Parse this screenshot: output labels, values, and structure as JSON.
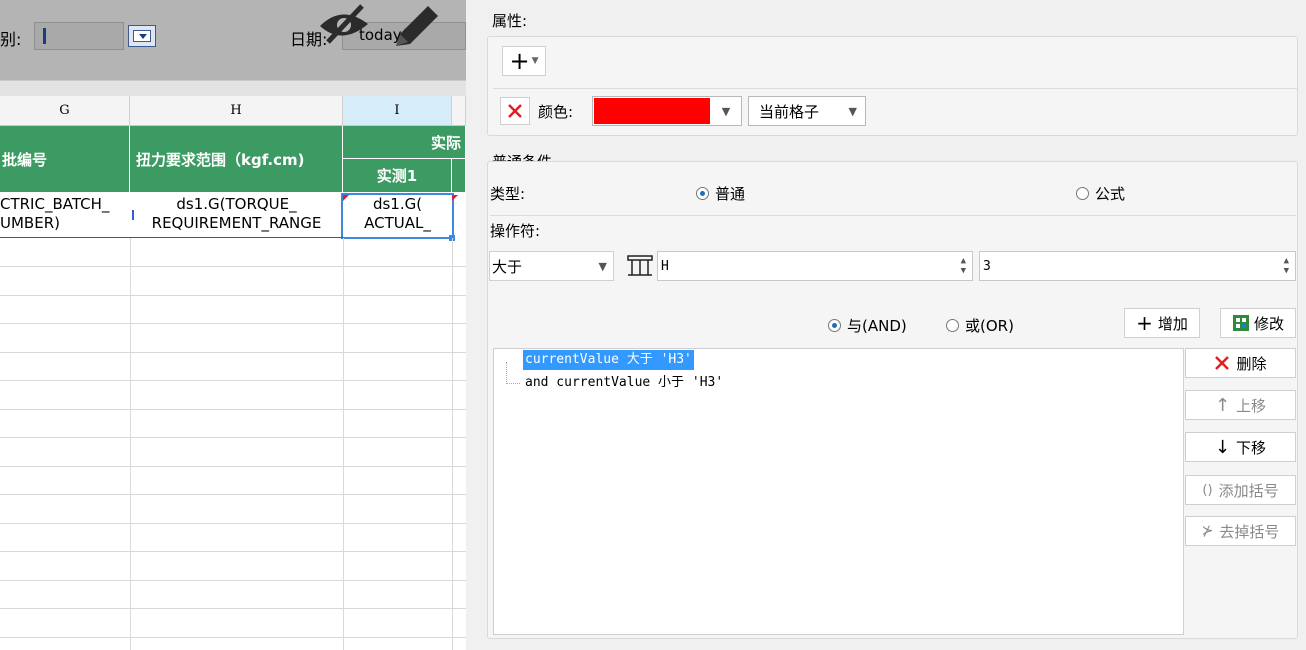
{
  "param_bar": {
    "category_label": "别:",
    "date_label": "日期:",
    "date_value": "today()"
  },
  "column_headers": [
    "G",
    "H",
    "I"
  ],
  "table_header": {
    "col_g": "批编号",
    "col_h": "扭力要求范围（kgf.cm)",
    "col_i_top": "实际",
    "col_i_sub": "实测1"
  },
  "data_row": {
    "col_g_line1": "CTRIC_BATCH_",
    "col_g_line2": "UMBER)",
    "col_h_line1": "ds1.G(TORQUE_",
    "col_h_line2": "REQUIREMENT_RANGE",
    "col_i_line1": "ds1.G(",
    "col_i_line2": "ACTUAL_"
  },
  "attributes": {
    "title": "属性:",
    "add_button": "+",
    "color_label": "颜色:",
    "color_value": "#ff0000",
    "scope_value": "当前格子"
  },
  "condition": {
    "title": "普通条件",
    "type_label": "类型:",
    "type_options": [
      "普通",
      "公式"
    ],
    "type_selected": "普通",
    "operator_label": "操作符:",
    "operator_value": "大于",
    "field_value": "H",
    "number_value": "3",
    "logic_options": [
      "与(AND)",
      "或(OR)"
    ],
    "logic_selected": "与(AND)",
    "add_label": "增加",
    "modify_label": "修改"
  },
  "expressions": [
    "currentValue 大于 'H3'",
    "and currentValue 小于 'H3'"
  ],
  "side_buttons": {
    "delete": "删除",
    "move_up": "上移",
    "move_down": "下移",
    "add_bracket": "添加括号",
    "remove_bracket": "去掉括号"
  },
  "colors": {
    "header_green": "#3c9a63",
    "selection_blue": "#3a88e0",
    "highlight": "#3399ff"
  }
}
